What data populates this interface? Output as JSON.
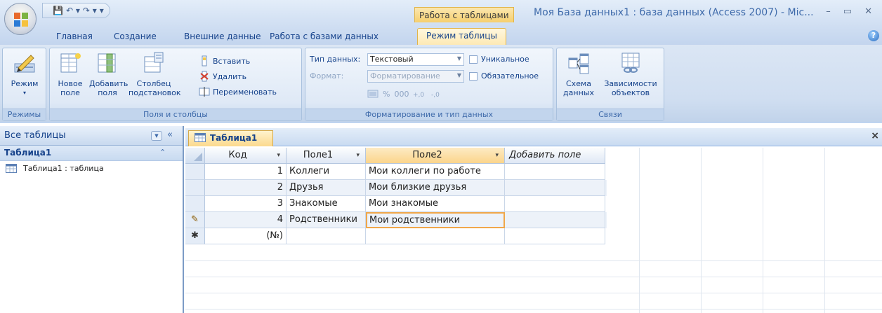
{
  "title_bar": {
    "context_tab": "Работа с таблицами",
    "window_title": "Моя База данных1 : база данных (Access 2007) - Mic...",
    "controls": [
      "–",
      "▭",
      "✕"
    ]
  },
  "quick_access": {
    "save": "💾",
    "undo": "↶ ▾",
    "redo": "↷ ▾",
    "customize": "▾"
  },
  "tabs": [
    "Главная",
    "Создание",
    "Внешние данные",
    "Работа с базами данных",
    "Режим таблицы"
  ],
  "ribbon": {
    "views": {
      "view_label": "Режим",
      "view_arrow": "▾",
      "group_label": "Режимы"
    },
    "fields_columns": {
      "new_field": "Новое\nполе",
      "add_fields": "Добавить\nполя",
      "lookup_column": "Столбец\nподстановок",
      "insert": "Вставить",
      "delete": "Удалить",
      "rename": "Переименовать",
      "group_label": "Поля и столбцы"
    },
    "format_datatype": {
      "datatype_label": "Тип данных:",
      "datatype_value": "Текстовый",
      "format_label": "Формат:",
      "format_value": "Форматирование",
      "unique_label": "Уникальное",
      "required_label": "Обязательное",
      "percent": "%",
      "thousands": "000",
      "group_label": "Форматирование и тип данных"
    },
    "relationships": {
      "relationships_label": "Схема\nданных",
      "dependencies_label": "Зависимости\nобъектов",
      "group_label": "Связи"
    }
  },
  "nav_pane": {
    "header": "Все таблицы",
    "collapse": "«",
    "dropdown": "▼",
    "group_chevron": "⌃",
    "group_title": "Таблица1",
    "item": "Таблица1 : таблица"
  },
  "document": {
    "tab_title": "Таблица1",
    "close": "×"
  },
  "datasheet": {
    "columns": [
      "Код",
      "Поле1",
      "Поле2",
      "Добавить поле"
    ],
    "dropdown_glyph": "▾",
    "rows": [
      {
        "selector": "",
        "id": "1",
        "field1": "Коллеги",
        "field2": "Мои коллеги по работе"
      },
      {
        "selector": "",
        "id": "2",
        "field1": "Друзья",
        "field2": "Мои близкие друзья"
      },
      {
        "selector": "",
        "id": "3",
        "field1": "Знакомые",
        "field2": "Мои знакомые"
      },
      {
        "selector": "✎",
        "id": "4",
        "field1": "Родственники",
        "field2": "Мои родственники"
      }
    ],
    "new_row": {
      "selector": "✱",
      "id": "(№)"
    }
  }
}
